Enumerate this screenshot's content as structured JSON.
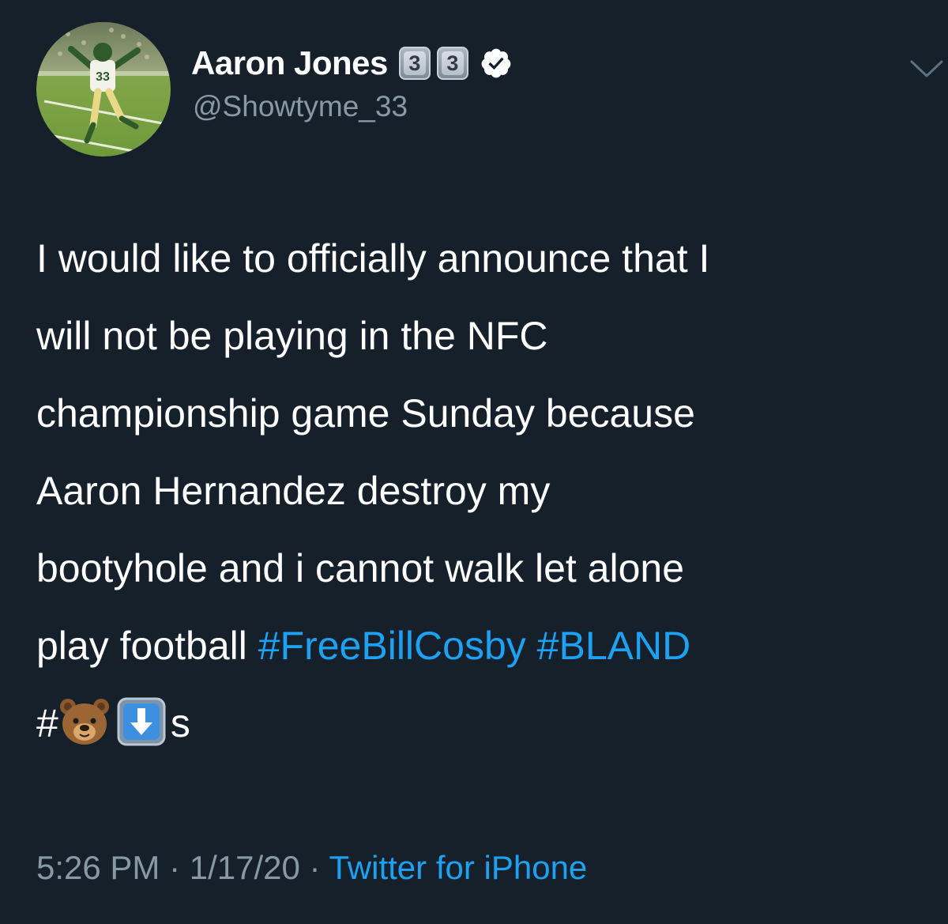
{
  "author": {
    "display_name": "Aaron Jones",
    "name_emojis": [
      "3",
      "3"
    ],
    "verified_icon": "verified-badge-icon",
    "handle": "@Showtyme_33",
    "avatar_icon": "football-player-avatar"
  },
  "menu_icon": "chevron-down-icon",
  "tweet": {
    "lines": [
      "I would like to officially announce that I",
      "will not be playing in the NFC",
      "championship game Sunday because",
      "Aaron Hernandez destroy my",
      "bootyhole and i cannot walk let alone"
    ],
    "line6_prefix": "play football ",
    "hashtags": [
      "#FreeBillCosby",
      "#BLAND"
    ],
    "line7_hash": "#",
    "line7_emojis": [
      "bear-face-emoji",
      "down-arrow-emoji"
    ],
    "line7_suffix": "s"
  },
  "footer": {
    "time": "5:26 PM",
    "separator": " · ",
    "date": "1/17/20",
    "source": "Twitter for iPhone"
  },
  "colors": {
    "background": "#15202b",
    "text": "#ffffff",
    "secondary": "#8899a6",
    "link": "#1da1f2"
  }
}
